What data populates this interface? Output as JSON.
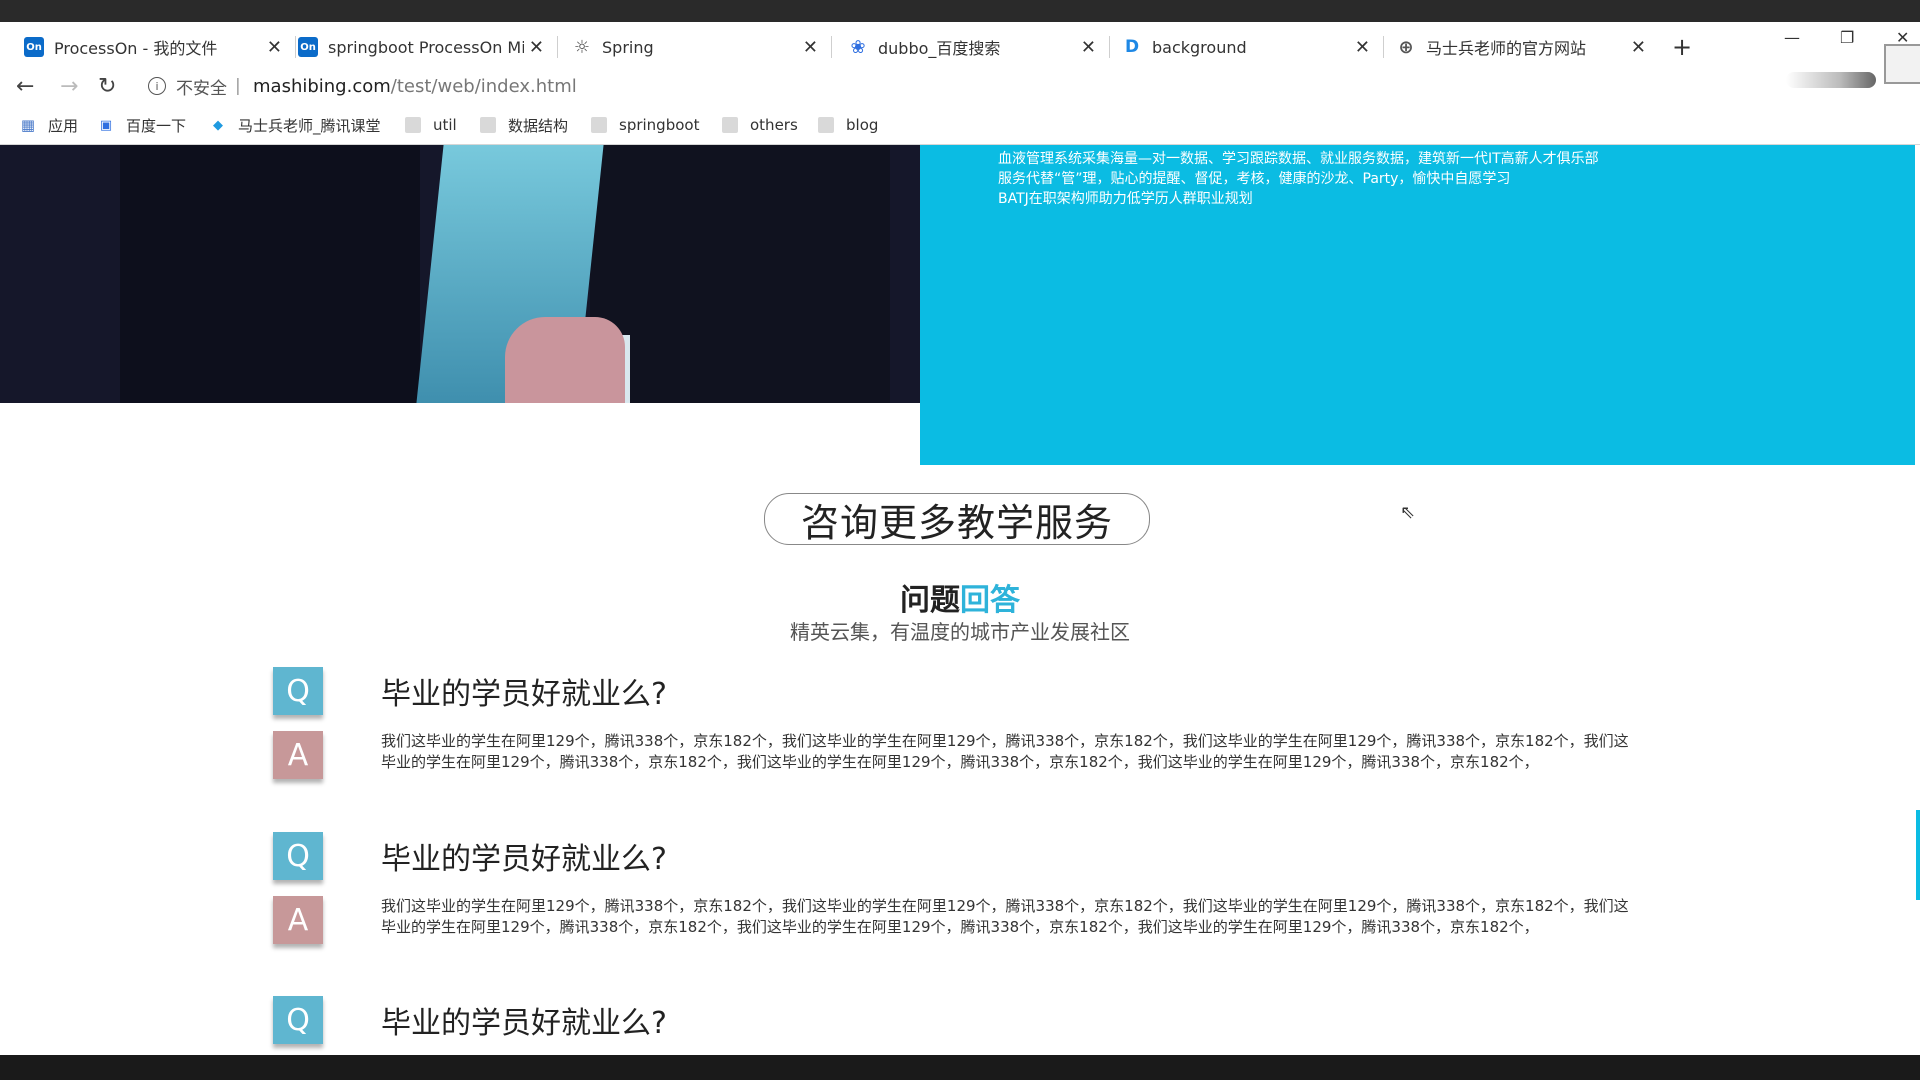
{
  "browser": {
    "tabs": [
      {
        "title": "ProcessOn - 我的文件",
        "icon": "processon-icon"
      },
      {
        "title": "springboot ProcessOn Mi",
        "icon": "processon-icon"
      },
      {
        "title": "Spring",
        "icon": "spring-icon"
      },
      {
        "title": "dubbo_百度搜索",
        "icon": "baidu-paw-icon"
      },
      {
        "title": "background",
        "icon": "d-icon"
      },
      {
        "title": "马士兵老师的官方网站",
        "icon": "globe-icon"
      }
    ],
    "security_label": "不安全",
    "url_host": "mashibing.com",
    "url_path": "/test/web/index.html",
    "bookmarks": [
      "应用",
      "百度一下",
      "马士兵老师_腾讯课堂",
      "util",
      "数据结构",
      "springboot",
      "others",
      "blog"
    ]
  },
  "promo": {
    "lines": [
      "血液管理系统采集海量—对一数据、学习跟踪数据、就业服务数据，建筑新一代IT高薪人才俱乐部",
      "服务代替“管”理，贴心的提醒、督促，考核，健康的沙龙、Party，愉快中自愿学习",
      "BATJ在职架构师助力低学历人群职业规划"
    ]
  },
  "consult_button": "咨询更多教学服务",
  "section": {
    "title_main": "问题",
    "title_accent": "回答",
    "subtitle": "精英云集，有温度的城市产业发展社区",
    "colors": {
      "accent": "#2eb3da",
      "promo_bg": "#0bbce3",
      "q_badge": "#5fb6d0",
      "a_badge": "#c79899"
    }
  },
  "faq": [
    {
      "q_badge": "Q",
      "a_badge": "A",
      "question": "毕业的学员好就业么?",
      "answer": "我们这毕业的学生在阿里129个，腾讯338个，京东182个，我们这毕业的学生在阿里129个，腾讯338个，京东182个，我们这毕业的学生在阿里129个，腾讯338个，京东182个，我们这毕业的学生在阿里129个，腾讯338个，京东182个，我们这毕业的学生在阿里129个，腾讯338个，京东182个，我们这毕业的学生在阿里129个，腾讯338个，京东182个，"
    },
    {
      "q_badge": "Q",
      "a_badge": "A",
      "question": "毕业的学员好就业么?",
      "answer": "我们这毕业的学生在阿里129个，腾讯338个，京东182个，我们这毕业的学生在阿里129个，腾讯338个，京东182个，我们这毕业的学生在阿里129个，腾讯338个，京东182个，我们这毕业的学生在阿里129个，腾讯338个，京东182个，我们这毕业的学生在阿里129个，腾讯338个，京东182个，我们这毕业的学生在阿里129个，腾讯338个，京东182个，"
    },
    {
      "q_badge": "Q",
      "question": "毕业的学员好就业么?"
    }
  ]
}
